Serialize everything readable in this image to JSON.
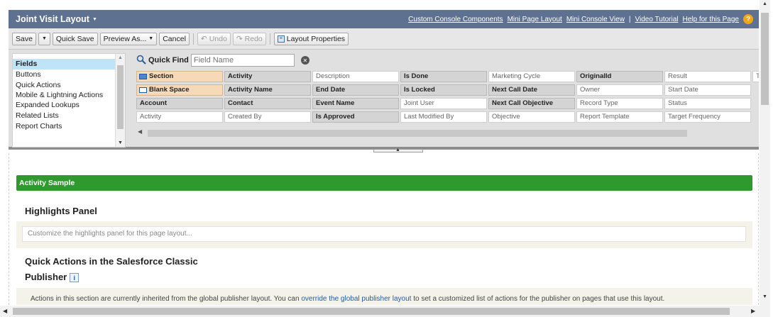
{
  "header": {
    "title": "Joint Visit Layout",
    "links": [
      "Custom Console Components",
      "Mini Page Layout",
      "Mini Console View",
      "Video Tutorial",
      "Help for this Page"
    ],
    "separator": "|"
  },
  "toolbar": {
    "save": "Save",
    "quick_save": "Quick Save",
    "preview_as": "Preview As...",
    "cancel": "Cancel",
    "undo": "Undo",
    "redo": "Redo",
    "layout_properties": "Layout Properties"
  },
  "palette": {
    "categories": [
      "Fields",
      "Buttons",
      "Quick Actions",
      "Mobile & Lightning Actions",
      "Expanded Lookups",
      "Related Lists",
      "Report Charts"
    ],
    "selected_category": "Fields",
    "quick_find_label": "Quick Find",
    "quick_find_placeholder": "Field Name",
    "fields": [
      [
        "Section",
        "Activity",
        "Description",
        "Is Done",
        "Marketing Cycle",
        "OriginalId",
        "Result",
        "T"
      ],
      [
        "Blank Space",
        "Activity Name",
        "End Date",
        "Is Locked",
        "Next Call Date",
        "Owner",
        "Start Date",
        ""
      ],
      [
        "Account",
        "Contact",
        "Event Name",
        "Joint User",
        "Next Call Objective",
        "Record Type",
        "Status",
        ""
      ],
      [
        "Activity",
        "Created By",
        "Is Approved",
        "Last Modified By",
        "Objective",
        "Report Template",
        "Target Frequency",
        ""
      ]
    ],
    "used_fields": [
      "Activity|0",
      "OriginalId",
      "Activity Name",
      "End Date",
      "Is Done",
      "Is Locked",
      "Next Call Date",
      "Account",
      "Contact",
      "Event Name",
      "Next Call Objective",
      "Is Approved"
    ]
  },
  "content": {
    "section_name": "Activity Sample",
    "highlights_title": "Highlights Panel",
    "highlights_hint": "Customize the highlights panel for this page layout...",
    "quick_actions_title_1": "Quick Actions in the Salesforce Classic",
    "quick_actions_title_2": "Publisher",
    "qa_text_before": "Actions in this section are currently inherited from the global publisher layout. You can ",
    "qa_link": "override the global publisher layout",
    "qa_text_after": " to set a customized list of actions for the publisher on pages that use this layout."
  },
  "colors": {
    "header_bg": "#5f7190",
    "section_green": "#2e9a2e",
    "selected_category": "#bfe3f7",
    "special_field": "#f7d9b8",
    "used_field": "#d4d4d4",
    "help_icon": "#f3a31a"
  }
}
